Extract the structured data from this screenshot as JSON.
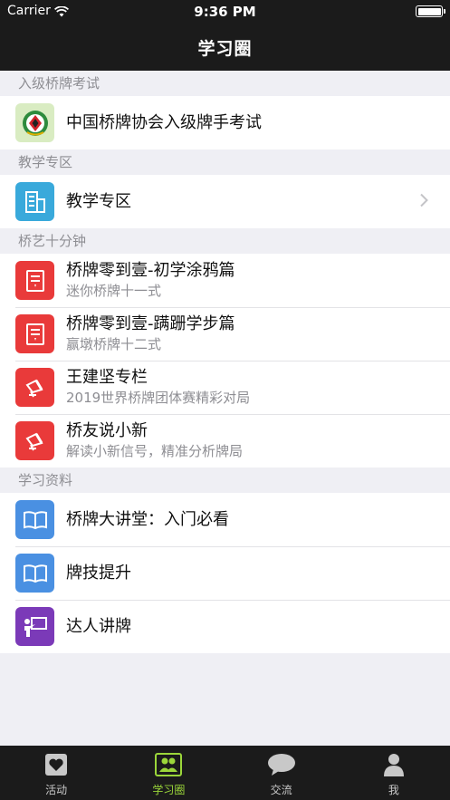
{
  "status_bar": {
    "carrier": "Carrier",
    "time": "9:36 PM"
  },
  "nav": {
    "title": "学习圈"
  },
  "sections": {
    "s1": {
      "header": "入级桥牌考试",
      "items": [
        {
          "title": "中国桥牌协会入级牌手考试"
        }
      ]
    },
    "s2": {
      "header": "教学专区",
      "items": [
        {
          "title": "教学专区"
        }
      ]
    },
    "s3": {
      "header": "桥艺十分钟",
      "items": [
        {
          "title": "桥牌零到壹-初学涂鸦篇",
          "subtitle": "迷你桥牌十一式"
        },
        {
          "title": "桥牌零到壹-蹒跚学步篇",
          "subtitle": "赢墩桥牌十二式"
        },
        {
          "title": "王建坚专栏",
          "subtitle": "2019世界桥牌团体赛精彩对局"
        },
        {
          "title": "桥友说小新",
          "subtitle": "解读小新信号，精准分析牌局"
        }
      ]
    },
    "s4": {
      "header": "学习资料",
      "items": [
        {
          "title": "桥牌大讲堂：入门必看"
        },
        {
          "title": "牌技提升"
        },
        {
          "title": "达人讲牌"
        }
      ]
    }
  },
  "tabs": [
    {
      "label": "活动",
      "icon": "heart-icon"
    },
    {
      "label": "学习圈",
      "icon": "people-icon",
      "active": true
    },
    {
      "label": "交流",
      "icon": "chat-bubble-icon"
    },
    {
      "label": "我",
      "icon": "person-icon"
    }
  ],
  "colors": {
    "bar_background": "#1b1b1b",
    "active_tab": "#9bd63a",
    "red_icon": "#e93a3a",
    "blue_icon": "#4a90e2",
    "purple_icon": "#7b3ab8",
    "cyan_icon": "#39a9db"
  }
}
